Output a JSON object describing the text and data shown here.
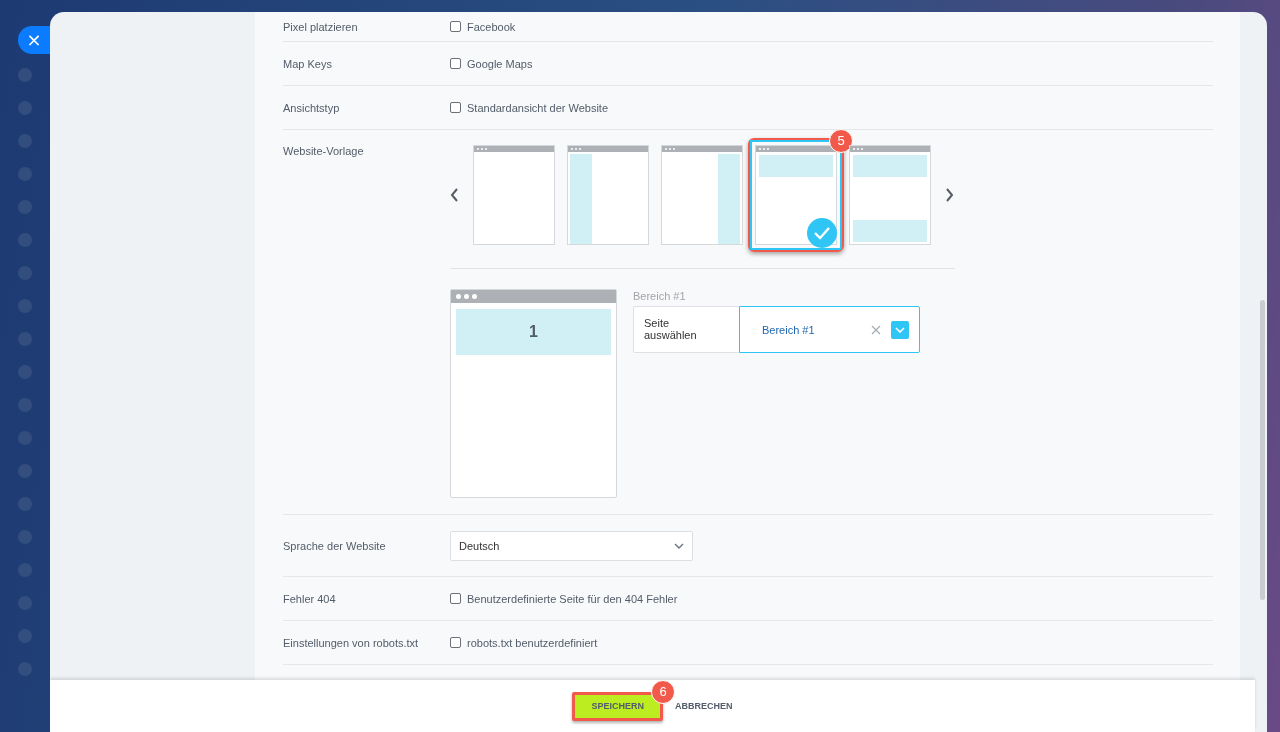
{
  "close_button": {
    "icon": "×"
  },
  "settings": [
    {
      "kind": "checkbox",
      "label": "Pixel platzieren",
      "option": "Facebook",
      "checked": false
    },
    {
      "kind": "checkbox",
      "label": "Map Keys",
      "option": "Google Maps",
      "checked": false
    },
    {
      "kind": "checkbox",
      "label": "Ansichtstyp",
      "option": "Standardansicht der Website",
      "checked": false
    },
    {
      "kind": "template",
      "label": "Website-Vorlage"
    },
    {
      "kind": "select",
      "label": "Sprache der Website",
      "value": "Deutsch"
    },
    {
      "kind": "checkbox",
      "label": "Fehler 404",
      "option": "Benutzerdefinierte Seite für den 404 Fehler",
      "checked": false
    },
    {
      "kind": "checkbox",
      "label": "Einstellungen von robots.txt",
      "option": "robots.txt benutzerdefiniert",
      "checked": false
    }
  ],
  "templates": [
    {
      "kind": "blank",
      "selected": false
    },
    {
      "kind": "left",
      "selected": false
    },
    {
      "kind": "right",
      "selected": false
    },
    {
      "kind": "top",
      "selected": true,
      "callout": "5"
    },
    {
      "kind": "top-bottom",
      "selected": false
    }
  ],
  "preview": {
    "area_number": "1"
  },
  "area_editor": {
    "label": "Bereich #1",
    "page_placeholder": "Seite auswählen",
    "area_value": "Bereich #1"
  },
  "footer": {
    "buttons": [
      {
        "label": "SPEICHERN",
        "kind": "primary",
        "callout": "6"
      },
      {
        "label": "ABBRECHEN",
        "kind": "link"
      }
    ]
  }
}
